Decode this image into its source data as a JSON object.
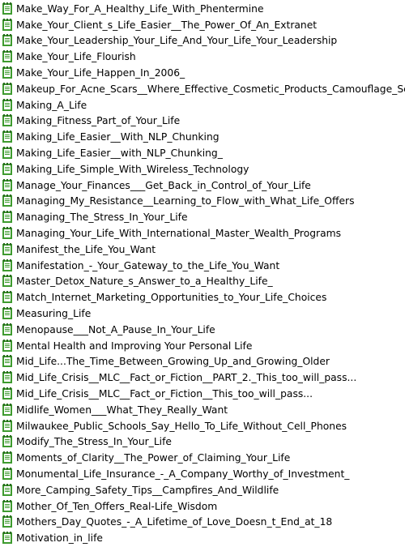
{
  "file_icon": "notepad-file-icon",
  "colors": {
    "icon_green": "#3e9b2f",
    "icon_paper": "#ffffff",
    "text": "#000000",
    "background": "#ffffff"
  },
  "files": [
    {
      "name": "Make_Way_For_A_Healthy_Life_With_Phentermine"
    },
    {
      "name": "Make_Your_Client_s_Life_Easier__The_Power_Of_An_Extranet"
    },
    {
      "name": "Make_Your_Leadership_Your_Life_And_Your_Life_Your_Leadership"
    },
    {
      "name": "Make_Your_Life_Flourish"
    },
    {
      "name": "Make_Your_Life_Happen_In_2006_"
    },
    {
      "name": "Makeup_For_Acne_Scars__Where_Effective_Cosmetic_Products_Camouflage_Scars_"
    },
    {
      "name": "Making_A_Life"
    },
    {
      "name": "Making_Fitness_Part_of_Your_Life"
    },
    {
      "name": "Making_Life_Easier__With_NLP_Chunking"
    },
    {
      "name": "Making_Life_Easier__with_NLP_Chunking_"
    },
    {
      "name": "Making_Life_Simple_With_Wireless_Technology"
    },
    {
      "name": "Manage_Your_Finances___Get_Back_in_Control_of_Your_Life"
    },
    {
      "name": "Managing_My_Resistance__Learning_to_Flow_with_What_Life_Offers"
    },
    {
      "name": "Managing_The_Stress_In_Your_Life"
    },
    {
      "name": "Managing_Your_Life_With_International_Master_Wealth_Programs"
    },
    {
      "name": "Manifest_the_Life_You_Want"
    },
    {
      "name": "Manifestation_-_Your_Gateway_to_the_Life_You_Want"
    },
    {
      "name": "Master_Detox_Nature_s_Answer_to_a_Healthy_Life_"
    },
    {
      "name": "Match_Internet_Marketing_Opportunities_to_Your_Life_Choices"
    },
    {
      "name": "Measuring_Life"
    },
    {
      "name": "Menopause___Not_A_Pause_In_Your_Life"
    },
    {
      "name": "Mental Health and Improving Your Personal Life"
    },
    {
      "name": "Mid_Life...The_Time_Between_Growing_Up_and_Growing_Older"
    },
    {
      "name": "Mid_Life_Crisis__MLC__Fact_or_Fiction__PART_2._This_too_will_pass..."
    },
    {
      "name": "Mid_Life_Crisis__MLC__Fact_or_Fiction__This_too_will_pass..."
    },
    {
      "name": "Midlife_Women___What_They_Really_Want"
    },
    {
      "name": "Milwaukee_Public_Schools_Say_Hello_To_Life_Without_Cell_Phones"
    },
    {
      "name": "Modify_The_Stress_In_Your_Life"
    },
    {
      "name": "Moments_of_Clarity__The_Power_of_Claiming_Your_Life"
    },
    {
      "name": "Monumental_Life_Insurance_-_A_Company_Worthy_of_Investment_"
    },
    {
      "name": "More_Camping_Safety_Tips__Campfires_And_Wildlife"
    },
    {
      "name": "Mother_Of_Ten_Offers_Real-Life_Wisdom"
    },
    {
      "name": "Mothers_Day_Quotes_-_A_Lifetime_of_Love_Doesn_t_End_at_18"
    },
    {
      "name": "Motivation_in_life"
    }
  ]
}
